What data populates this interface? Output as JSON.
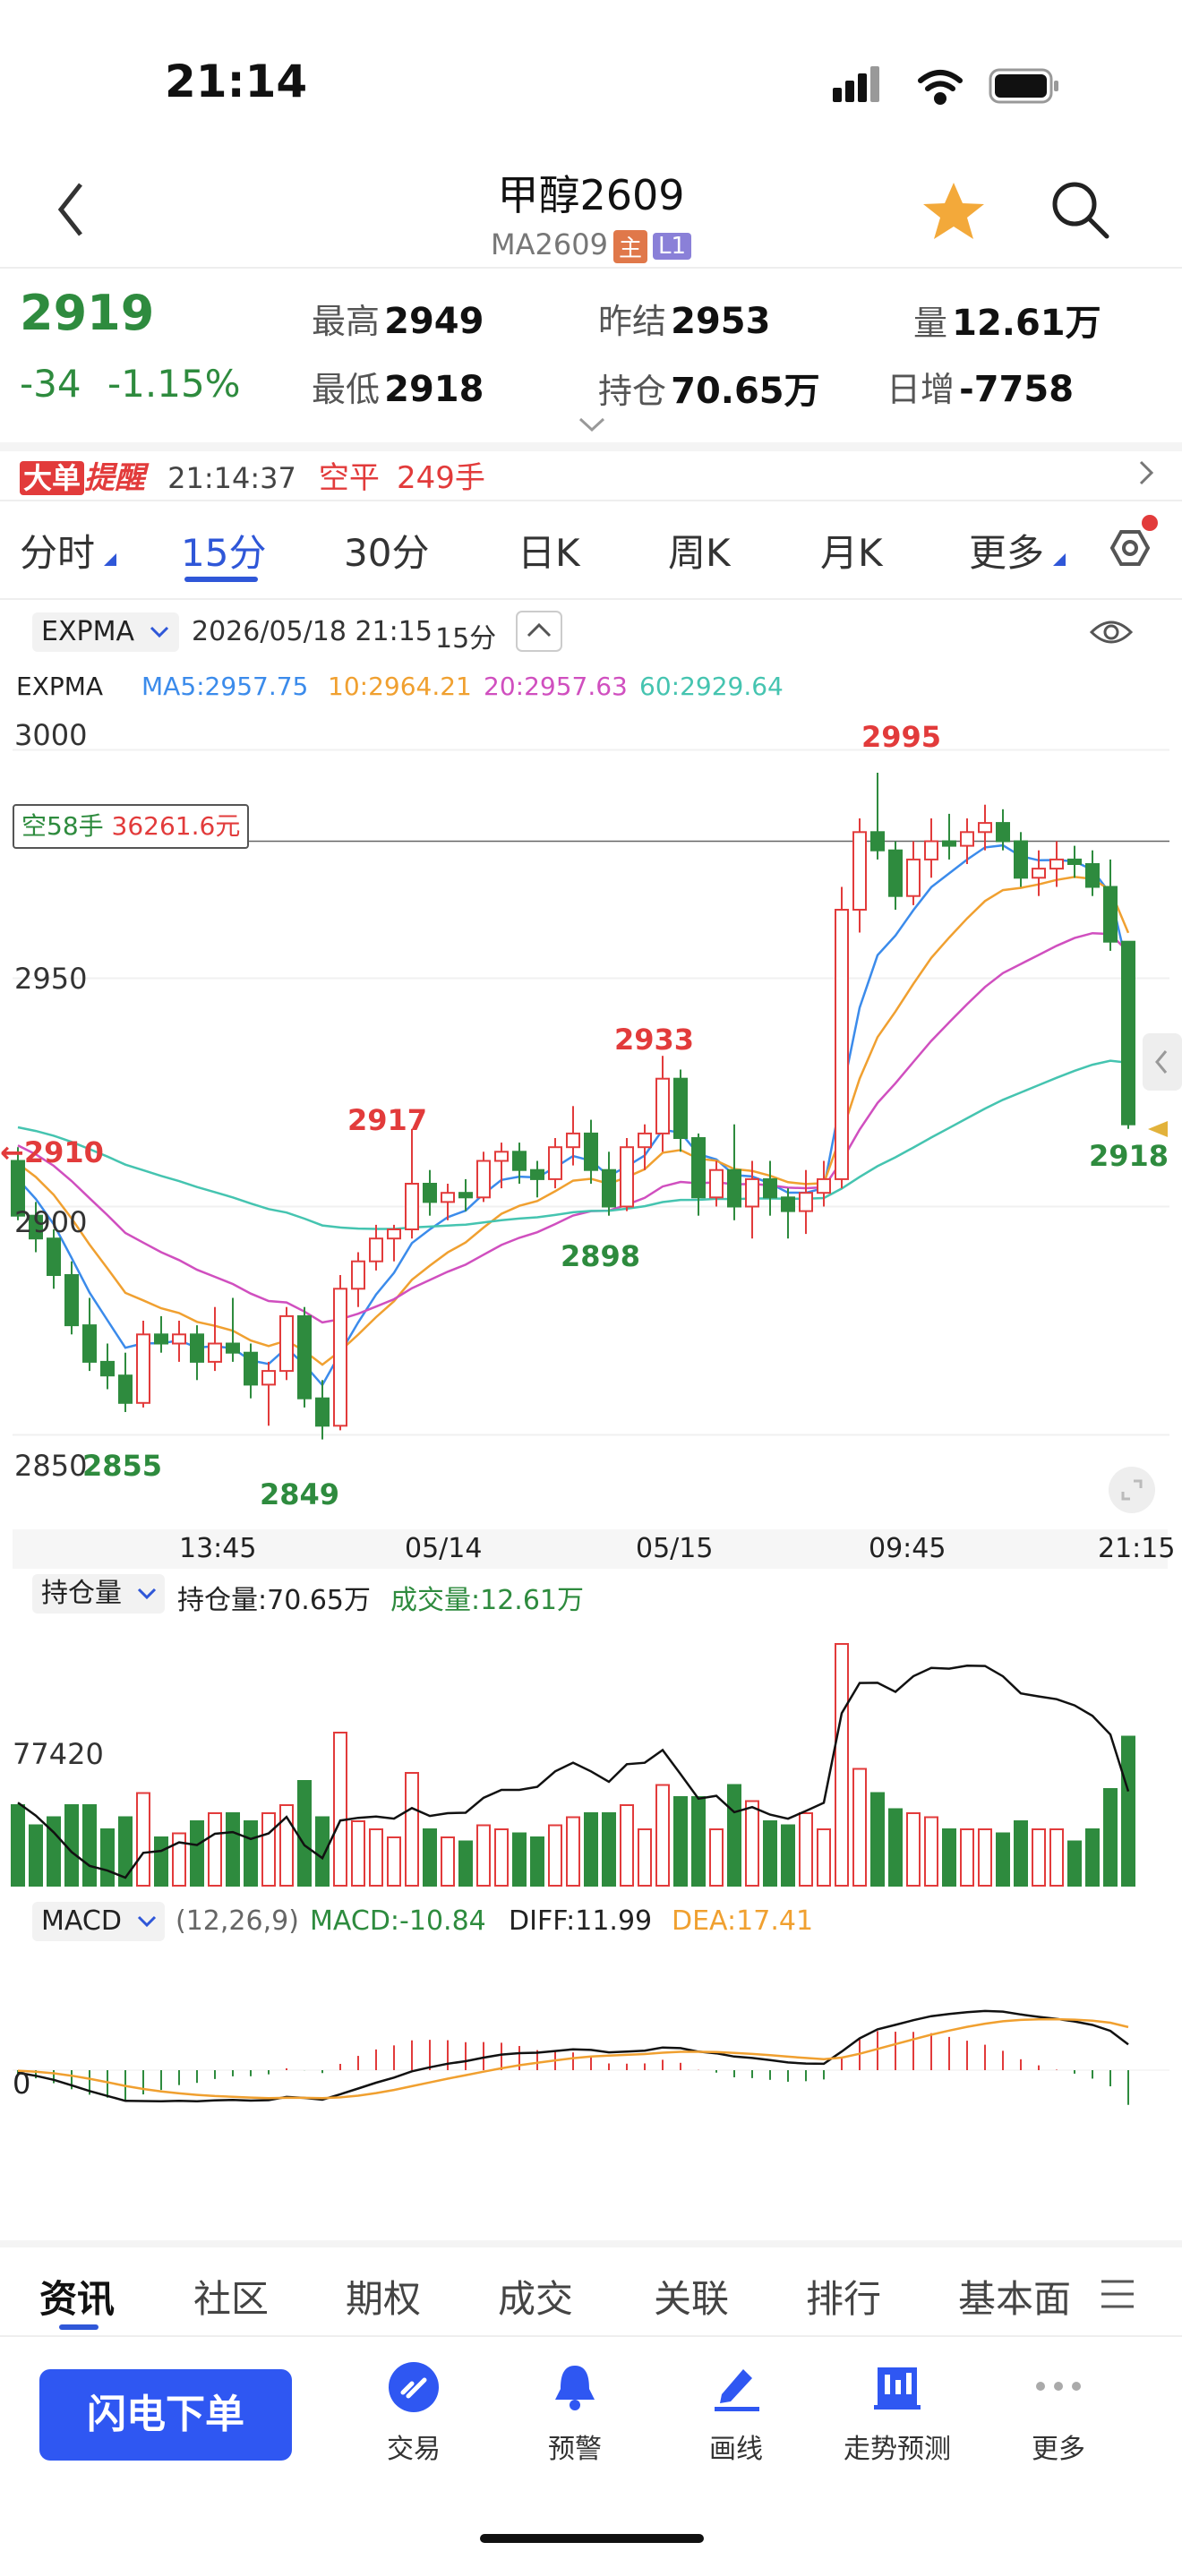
{
  "status": {
    "time": "21:14"
  },
  "header": {
    "title": "甲醇2609",
    "code": "MA2609",
    "tag_main": "主",
    "tag_l1": "L1"
  },
  "quote": {
    "price": "2919",
    "change": "-34",
    "change_pct": "-1.15%",
    "high_label": "最高",
    "high": "2949",
    "low_label": "最低",
    "low": "2918",
    "prev_settle_label": "昨结",
    "prev_settle": "2953",
    "open_interest_label": "持仓",
    "open_interest": "70.65万",
    "volume_label": "量",
    "volume": "12.61万",
    "daily_inc_label": "日增",
    "daily_inc": "-7758"
  },
  "alert": {
    "tag1": "大单",
    "tag2": "提醒",
    "time": "21:14:37",
    "action": "空平",
    "qty": "249手"
  },
  "period_tabs": [
    "分时",
    "15分",
    "30分",
    "日K",
    "周K",
    "月K",
    "更多"
  ],
  "active_tab": "15分",
  "chart_toolbar": {
    "indicator": "EXPMA",
    "datetime": "2026/05/18 21:15",
    "period": "15分"
  },
  "expma_legend": {
    "name": "EXPMA",
    "ma5": "MA5:2957.75",
    "ma10": "10:2964.21",
    "ma20": "20:2957.63",
    "ma60": "60:2929.64"
  },
  "position_tag": {
    "side": "空58手",
    "amount": "36261.6元"
  },
  "xaxis_labels": [
    "13:45",
    "05/14",
    "05/15",
    "09:45",
    "21:15"
  ],
  "volume_panel": {
    "indicator": "持仓量",
    "oi_label": "持仓量:70.65万",
    "vol_label": "成交量:12.61万",
    "yval": "77420"
  },
  "macd_panel": {
    "indicator": "MACD",
    "params": "(12,26,9)",
    "macd": "MACD:-10.84",
    "diff": "DIFF:11.99",
    "dea": "DEA:17.41",
    "zero": "0"
  },
  "bottom_tabs": [
    "资讯",
    "社区",
    "期权",
    "成交",
    "关联",
    "排行",
    "基本面"
  ],
  "toolbar": {
    "flash_order": "闪电下单",
    "trade": "交易",
    "alert": "预警",
    "draw": "画线",
    "predict": "走势预测",
    "more": "更多"
  },
  "colors": {
    "up": "#e23b3b",
    "down": "#2e8b3e",
    "accent": "#2f57d8",
    "ma5": "#3b8beb",
    "ma10": "#f0a030",
    "ma20": "#d04fbf",
    "ma60": "#45c4b0"
  },
  "chart_data": {
    "type": "candlestick",
    "ylim": [
      2845,
      3005
    ],
    "yticks": [
      3000,
      2950,
      2900,
      2850
    ],
    "candles": [
      [
        2910,
        2913,
        2897,
        2898
      ],
      [
        2898,
        2901,
        2890,
        2893
      ],
      [
        2893,
        2895,
        2882,
        2885
      ],
      [
        2885,
        2888,
        2872,
        2874
      ],
      [
        2874,
        2880,
        2864,
        2866
      ],
      [
        2866,
        2870,
        2860,
        2863
      ],
      [
        2863,
        2868,
        2855,
        2857
      ],
      [
        2857,
        2875,
        2856,
        2872
      ],
      [
        2872,
        2876,
        2868,
        2870
      ],
      [
        2870,
        2875,
        2866,
        2872
      ],
      [
        2872,
        2874,
        2862,
        2866
      ],
      [
        2866,
        2878,
        2864,
        2870
      ],
      [
        2870,
        2880,
        2866,
        2868
      ],
      [
        2868,
        2870,
        2858,
        2861
      ],
      [
        2861,
        2866,
        2852,
        2864
      ],
      [
        2864,
        2878,
        2862,
        2876
      ],
      [
        2876,
        2878,
        2856,
        2858
      ],
      [
        2858,
        2862,
        2849,
        2852
      ],
      [
        2852,
        2885,
        2851,
        2882
      ],
      [
        2882,
        2890,
        2878,
        2888
      ],
      [
        2888,
        2896,
        2886,
        2893
      ],
      [
        2893,
        2896,
        2888,
        2895
      ],
      [
        2895,
        2917,
        2893,
        2905
      ],
      [
        2905,
        2908,
        2898,
        2901
      ],
      [
        2901,
        2905,
        2897,
        2903
      ],
      [
        2903,
        2906,
        2899,
        2902
      ],
      [
        2902,
        2912,
        2901,
        2910
      ],
      [
        2910,
        2914,
        2904,
        2912
      ],
      [
        2912,
        2914,
        2905,
        2908
      ],
      [
        2908,
        2910,
        2902,
        2906
      ],
      [
        2906,
        2915,
        2904,
        2913
      ],
      [
        2913,
        2922,
        2909,
        2916
      ],
      [
        2916,
        2919,
        2905,
        2908
      ],
      [
        2908,
        2912,
        2898,
        2900
      ],
      [
        2900,
        2915,
        2899,
        2913
      ],
      [
        2913,
        2918,
        2908,
        2916
      ],
      [
        2916,
        2933,
        2912,
        2928
      ],
      [
        2928,
        2930,
        2912,
        2915
      ],
      [
        2915,
        2916,
        2898,
        2902
      ],
      [
        2902,
        2910,
        2900,
        2908
      ],
      [
        2908,
        2918,
        2897,
        2900
      ],
      [
        2900,
        2910,
        2893,
        2906
      ],
      [
        2906,
        2910,
        2898,
        2902
      ],
      [
        2902,
        2904,
        2893,
        2899
      ],
      [
        2899,
        2908,
        2894,
        2903
      ],
      [
        2903,
        2910,
        2900,
        2906
      ],
      [
        2906,
        2970,
        2904,
        2965
      ],
      [
        2965,
        2985,
        2960,
        2982
      ],
      [
        2982,
        2995,
        2976,
        2978
      ],
      [
        2978,
        2980,
        2965,
        2968
      ],
      [
        2968,
        2980,
        2966,
        2976
      ],
      [
        2976,
        2985,
        2972,
        2980
      ],
      [
        2980,
        2986,
        2976,
        2979
      ],
      [
        2979,
        2985,
        2975,
        2982
      ],
      [
        2982,
        2988,
        2978,
        2984
      ],
      [
        2984,
        2987,
        2978,
        2980
      ],
      [
        2980,
        2982,
        2970,
        2972
      ],
      [
        2972,
        2978,
        2968,
        2974
      ],
      [
        2974,
        2980,
        2970,
        2976
      ],
      [
        2976,
        2979,
        2972,
        2975
      ],
      [
        2975,
        2978,
        2968,
        2970
      ],
      [
        2970,
        2976,
        2956,
        2958
      ],
      [
        2958,
        2950,
        2917,
        2918
      ]
    ]
  }
}
